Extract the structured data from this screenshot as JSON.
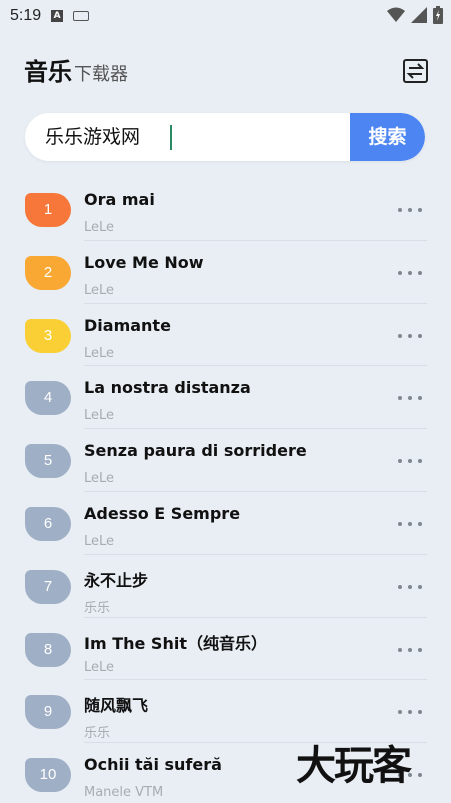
{
  "status_bar": {
    "time": "5:19",
    "left_icons": [
      "notification-a-icon",
      "keyboard-icon"
    ],
    "right_icons": [
      "wifi-icon",
      "signal-icon",
      "battery-icon"
    ]
  },
  "header": {
    "title": "音乐",
    "subtitle": "下载器",
    "switch_icon": "swap-icon"
  },
  "search": {
    "value": "乐乐游戏网",
    "button_label": "搜索"
  },
  "songs": [
    {
      "rank": "1",
      "title": "Ora mai",
      "artist": "LeLe",
      "rank_color": "#f7773a"
    },
    {
      "rank": "2",
      "title": "Love Me Now",
      "artist": "LeLe",
      "rank_color": "#f9a834"
    },
    {
      "rank": "3",
      "title": "Diamante",
      "artist": "LeLe",
      "rank_color": "#f9cf35"
    },
    {
      "rank": "4",
      "title": "La nostra distanza",
      "artist": "LeLe",
      "rank_color": "#9fb0c6"
    },
    {
      "rank": "5",
      "title": "Senza paura di sorridere",
      "artist": "LeLe",
      "rank_color": "#9fb0c6"
    },
    {
      "rank": "6",
      "title": "Adesso E Sempre",
      "artist": "LeLe",
      "rank_color": "#9fb0c6"
    },
    {
      "rank": "7",
      "title": "永不止步",
      "artist": "乐乐",
      "rank_color": "#9fb0c6"
    },
    {
      "rank": "8",
      "title": "Im The Shit（纯音乐）",
      "artist": "LeLe",
      "rank_color": "#9fb0c6"
    },
    {
      "rank": "9",
      "title": "随风飘飞",
      "artist": "乐乐",
      "rank_color": "#9fb0c6"
    },
    {
      "rank": "10",
      "title": "Ochii tăi suferă",
      "artist": "Manele VTM",
      "rank_color": "#9fb0c6"
    }
  ],
  "watermark": "大玩客",
  "colors": {
    "background": "#e8eef4",
    "accent": "#4d86f3"
  }
}
